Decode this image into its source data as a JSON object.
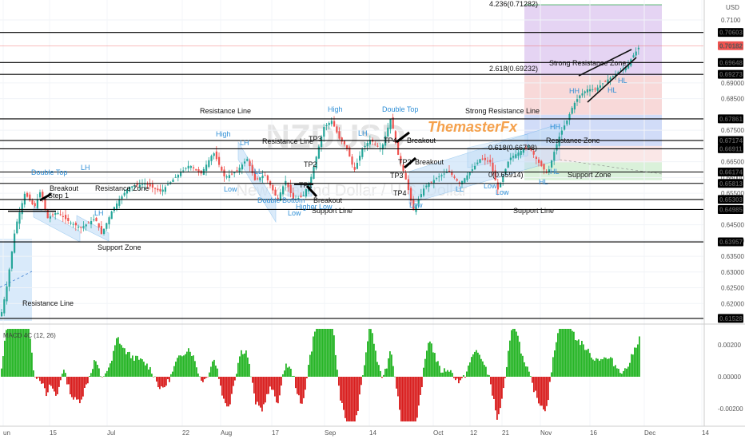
{
  "chart_data": {
    "type": "candlestick",
    "watermark": "NZDUSD",
    "watermark_sub": "New Zealand Dollar / U.S. Dollar",
    "brand": "ThemasterFx",
    "currency": "USD",
    "price_axis": {
      "range": [
        0.6145,
        0.7143
      ],
      "ticks": [
        "0.7100",
        "0.69000",
        "0.68500",
        "0.67500",
        "0.66500",
        "0.66000",
        "0.65500",
        "0.64500",
        "0.64000",
        "0.63500",
        "0.63000",
        "0.62500",
        "0.62000"
      ],
      "tick_values": [
        0.71,
        0.69,
        0.685,
        0.675,
        0.665,
        0.66,
        0.655,
        0.645,
        0.64,
        0.635,
        0.63,
        0.625,
        0.62
      ]
    },
    "time_axis": {
      "labels": [
        "un",
        "15",
        "Jul",
        "22",
        "Aug",
        "17",
        "Sep",
        "14",
        "Oct",
        "12",
        "21",
        "Nov",
        "16",
        "Dec",
        "14"
      ]
    },
    "horizontal_levels": [
      0.70603,
      0.69648,
      0.69273,
      0.67861,
      0.67174,
      0.66911,
      0.66174,
      0.65813,
      0.65303,
      0.64985,
      0.63957,
      0.61528
    ],
    "level_labels": [
      "0.70603",
      "0.69648",
      "0.69273",
      "0.67861",
      "0.67174",
      "0.66911",
      "0.66174",
      "0.65813",
      "0.65303",
      "0.64985",
      "0.63957",
      "0.61528"
    ],
    "current_price": "0.70182",
    "current_value": 0.70182,
    "fib_labels": {
      "f4236": "4.236(0.71282)",
      "f2618": "2.618(0.69232)",
      "f1618": "1.618(0.6799)",
      "f0618": "0.618(0.66798)",
      "f0": "0(0.65914)"
    },
    "annotations": {
      "double_top_1": "Double Top",
      "double_top_2": "Double Top",
      "breakout": "Breakout",
      "step1": "Step 1",
      "resistance_zone_1": "Resistance Zone",
      "resistance_zone_2": "Resistance Zone",
      "resistance_line_1": "Resistance Line",
      "resistance_line_2": "Resistance Line",
      "resistance_line_3": "Resistance Line",
      "strong_resistance_1": "Strong Resistance Line",
      "strong_resistance_2": "Strong Resistance Zone",
      "support_zone_1": "Support Zone",
      "support_zone_2": "Support Zone",
      "support_line_1": "Support Line",
      "support_line_2": "Support Line",
      "double_bottom": "Double Bottom",
      "high": "High",
      "higher_low": "Higher Low",
      "low": "Low",
      "hh": "HH",
      "hl": "HL",
      "lh": "LH",
      "ll": "LL",
      "tp1": "TP1",
      "tp2": "TP2",
      "tp3": "TP3",
      "tp4": "TP4"
    },
    "macd": {
      "label": "MACD 4C (12, 26)",
      "ticks": [
        "0.00200",
        "0.00000",
        "-0.00200"
      ],
      "tick_values": [
        0.002,
        0.0,
        -0.002
      ],
      "range": [
        -0.0028,
        0.003
      ]
    },
    "colors": {
      "up": "#26a69a",
      "down": "#ef5350",
      "macd_pos": "#26b526",
      "macd_neg": "#d91e1e",
      "fib_purple": "#dcc6ef",
      "fib_red": "#f6cfcf",
      "fib_blue": "#c9d6f7",
      "fib_green": "#d6f0d6",
      "channel": "#bfdcf7",
      "brand": "#f5a14c"
    }
  }
}
